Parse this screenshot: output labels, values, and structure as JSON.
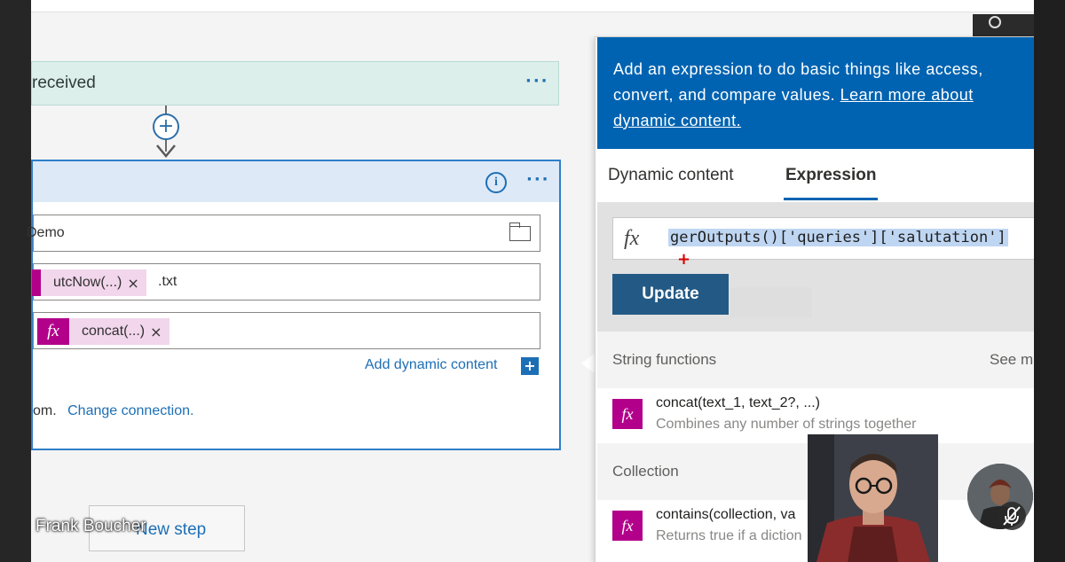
{
  "trigger": {
    "label": "received",
    "more": "···"
  },
  "action": {
    "more": "···",
    "info": "i",
    "folder_value": "Demo",
    "filename_token": "utcNow(...)",
    "filename_suffix": ".txt",
    "content_token": "concat(...)",
    "token_remove": "×",
    "fx": "fx",
    "add_dynamic": "Add dynamic content",
    "add_dynamic_icon": "+",
    "connection_prefix": "om.",
    "connection_link": "Change connection."
  },
  "connector": {
    "plus": "+"
  },
  "new_step": {
    "label": "New step"
  },
  "presenter": {
    "name": "Frank Boucher"
  },
  "panel": {
    "banner_text": "Add an expression to do basic things like access, convert, and compare values. ",
    "banner_link": "Learn more about dynamic content.",
    "tabs": [
      {
        "label": "Dynamic content"
      },
      {
        "label": "Expression"
      }
    ],
    "expression": {
      "fx": "fx",
      "value": "gerOutputs()['queries']['salutation']"
    },
    "update_label": "Update",
    "sections": [
      {
        "title": "String functions",
        "see_more": "See m",
        "function": {
          "name": "concat(text_1, text_2?, ...)",
          "desc": "Combines any number of strings together"
        }
      },
      {
        "title": "Collection",
        "function": {
          "name": "contains(collection, va",
          "desc": "Returns true if a diction"
        }
      }
    ]
  },
  "colors": {
    "accent": "#0063b1",
    "fx_token": "#b2008a",
    "trigger_bg": "#dcefeb",
    "update_button": "#235a85"
  }
}
